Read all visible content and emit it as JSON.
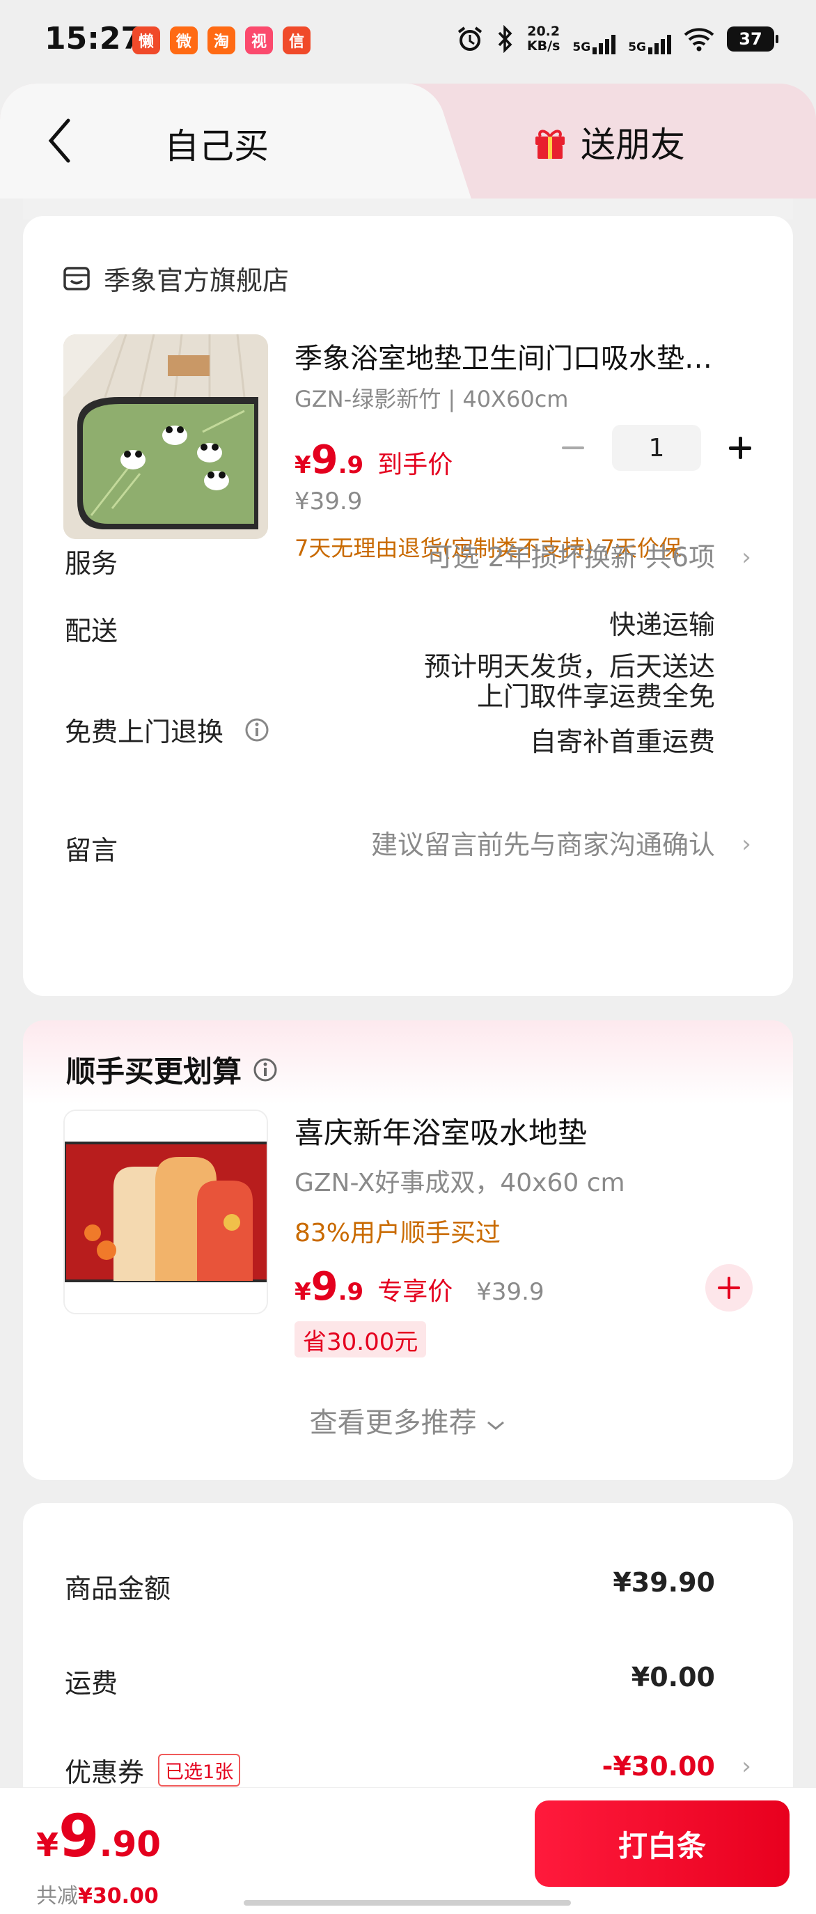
{
  "status_bar": {
    "time": "15:27",
    "app_icons": [
      "懒",
      "微",
      "淘",
      "视",
      "信"
    ],
    "net_speed_value": "20.2",
    "net_speed_unit": "KB/s",
    "signal1_label": "5G",
    "signal2_label": "5G",
    "battery": "37"
  },
  "header": {
    "tab_self": "自己买",
    "tab_friend": "送朋友"
  },
  "shop": {
    "name": "季象官方旗舰店"
  },
  "product": {
    "title": "季象浴室地垫卫生间门口吸水垫…",
    "spec": "GZN-绿影新竹 | 40X60cm",
    "price_currency": "¥",
    "price_int": "9",
    "price_dec": ".9",
    "price_tag": "到手价",
    "original_price": "¥39.9",
    "guarantee": "7天无理由退货(定制类不支持) 7天价保",
    "quantity": "1"
  },
  "rows": {
    "service_label": "服务",
    "service_value": "可选 2年损坏换新 共6项",
    "delivery_label": "配送",
    "delivery_value_1": "快递运输",
    "delivery_value_2": "预计明天发货，后天送达",
    "return_label": "免费上门退换",
    "return_value_1": "上门取件享运费全免",
    "return_value_2": "自寄补首重运费",
    "message_label": "留言",
    "message_placeholder": "建议留言前先与商家沟通确认"
  },
  "recommend": {
    "title": "顺手买更划算",
    "item_name": "喜庆新年浴室吸水地垫",
    "item_spec": "GZN-X好事成双，40x60 cm",
    "item_bought": "83%用户顺手买过",
    "price_currency": "¥",
    "price_int": "9",
    "price_dec": ".9",
    "price_tag": "专享价",
    "original_price": "¥39.9",
    "save": "省30.00元",
    "more": "查看更多推荐"
  },
  "summary": {
    "goods_label": "商品金额",
    "goods_value": "¥39.90",
    "shipping_label": "运费",
    "shipping_value": "¥0.00",
    "coupon_label": "优惠券",
    "coupon_tag": "已选1张",
    "coupon_value": "-¥30.00"
  },
  "bottom": {
    "total_currency": "¥",
    "total_int": "9",
    "total_dec": ".90",
    "save_prefix": "共减",
    "save_amount": "¥30.00",
    "pay_button": "打白条"
  },
  "colors": {
    "accent": "#e4001e",
    "guarantee": "#c96a00",
    "background": "#efefef"
  }
}
